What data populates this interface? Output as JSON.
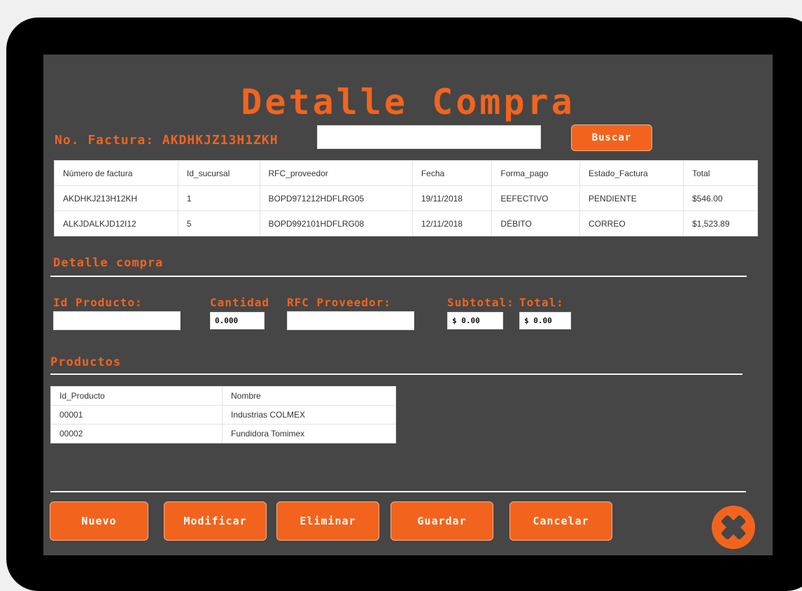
{
  "title": "Detalle Compra",
  "search": {
    "factura_label": "No. Factura: AKDHKJZ13H1ZKH",
    "input_value": "",
    "button_label": "Buscar"
  },
  "facturas": {
    "headers": [
      "Número de factura",
      "Id_sucursal",
      "RFC_proveedor",
      "Fecha",
      "Forma_pago",
      "Estado_Factura",
      "Total"
    ],
    "rows": [
      [
        "AKDHKJ213H12KH",
        "1",
        "BOPD971212HDFLRG05",
        "19/11/2018",
        "EEFECTIVO",
        "PENDIENTE",
        "$546.00"
      ],
      [
        "ALKJDALKJD12I12",
        "5",
        "BOPD992101HDFLRG08",
        "12/11/2018",
        "DÉBITO",
        "CORREO",
        "$1,523.89"
      ]
    ]
  },
  "detalle": {
    "section_title": "Detalle compra",
    "id_producto_label": "Id Producto:",
    "cantidad_label": "Cantidad",
    "rfc_label": "RFC Proveedor:",
    "subtotal_label": "Subtotal:",
    "total_label": "Total:",
    "cantidad_value": "0.000",
    "subtotal_value": "$ 0.00",
    "total_value": "$ 0.00"
  },
  "productos": {
    "section_title": "Productos",
    "headers": [
      "Id_Producto",
      "Nombre"
    ],
    "rows": [
      [
        "00001",
        "Industrias COLMEX"
      ],
      [
        "00002",
        "Fundidora Tomimex"
      ]
    ]
  },
  "actions": {
    "nuevo": "Nuevo",
    "modificar": "Modificar",
    "eliminar": "Eliminar",
    "guardar": "Guardar",
    "cancelar": "Cancelar",
    "close_icon": "close-icon"
  },
  "colors": {
    "accent": "#f2641e",
    "panel": "#464646",
    "frame": "#000000"
  }
}
